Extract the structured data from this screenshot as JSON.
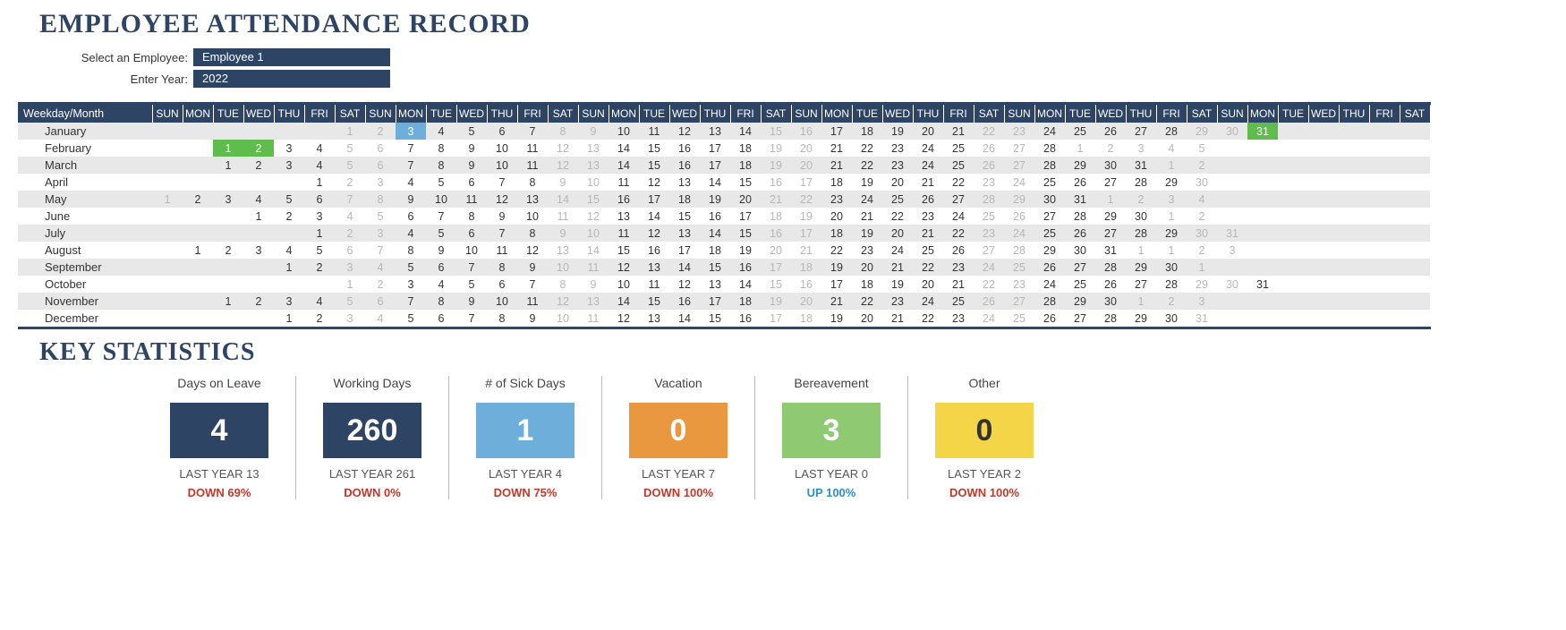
{
  "title": "EMPLOYEE ATTENDANCE RECORD",
  "controls": {
    "employee_label": "Select an Employee:",
    "employee_value": "Employee 1",
    "year_label": "Enter Year:",
    "year_value": "2022"
  },
  "calendar": {
    "header_label": "Weekday/Month",
    "weekdays_short": [
      "SUN",
      "MON",
      "TUE",
      "WED",
      "THU",
      "FRI",
      "SAT"
    ],
    "columns": 42,
    "months": [
      {
        "name": "January",
        "first_dow": 6,
        "days": 31,
        "highlights": {
          "3": "blue",
          "31": "green"
        }
      },
      {
        "name": "February",
        "first_dow": 2,
        "days": 28,
        "highlights": {
          "1": "green",
          "2": "green"
        },
        "trailing": [
          1,
          2,
          3,
          4,
          5
        ]
      },
      {
        "name": "March",
        "first_dow": 2,
        "days": 31,
        "highlights": {},
        "trailing": [
          1,
          2
        ]
      },
      {
        "name": "April",
        "first_dow": 5,
        "days": 30,
        "highlights": {}
      },
      {
        "name": "May",
        "first_dow": 0,
        "days": 31,
        "highlights": {},
        "trailing": [
          1,
          2,
          3,
          4
        ]
      },
      {
        "name": "June",
        "first_dow": 3,
        "days": 30,
        "highlights": {},
        "trailing": [
          1,
          2
        ]
      },
      {
        "name": "July",
        "first_dow": 5,
        "days": 31,
        "highlights": {}
      },
      {
        "name": "August",
        "first_dow": 1,
        "days": 31,
        "highlights": {},
        "trailing": [
          1,
          1,
          2,
          3
        ]
      },
      {
        "name": "September",
        "first_dow": 4,
        "days": 30,
        "highlights": {},
        "trailing": [
          1
        ]
      },
      {
        "name": "October",
        "first_dow": 6,
        "days": 31,
        "highlights": {}
      },
      {
        "name": "November",
        "first_dow": 2,
        "days": 30,
        "highlights": {},
        "trailing": [
          1,
          2,
          3
        ]
      },
      {
        "name": "December",
        "first_dow": 4,
        "days": 31,
        "highlights": {}
      }
    ]
  },
  "stats_title": "KEY STATISTICS",
  "stats": [
    {
      "label": "Days on Leave",
      "value": "4",
      "bg": "#2e4465",
      "fg": "#ffffff",
      "last_year": "LAST YEAR  13",
      "delta": "DOWN 69%",
      "dir": "down"
    },
    {
      "label": "Working Days",
      "value": "260",
      "bg": "#2e4465",
      "fg": "#ffffff",
      "last_year": "LAST YEAR  261",
      "delta": "DOWN 0%",
      "dir": "down"
    },
    {
      "label": "# of Sick Days",
      "value": "1",
      "bg": "#6eaedb",
      "fg": "#ffffff",
      "last_year": "LAST YEAR  4",
      "delta": "DOWN 75%",
      "dir": "down"
    },
    {
      "label": "Vacation",
      "value": "0",
      "bg": "#e9983f",
      "fg": "#ffffff",
      "last_year": "LAST YEAR  7",
      "delta": "DOWN 100%",
      "dir": "down"
    },
    {
      "label": "Bereavement",
      "value": "3",
      "bg": "#8fc972",
      "fg": "#ffffff",
      "last_year": "LAST YEAR  0",
      "delta": "UP 100%",
      "dir": "up"
    },
    {
      "label": "Other",
      "value": "0",
      "bg": "#f4d547",
      "fg": "#333333",
      "last_year": "LAST YEAR  2",
      "delta": "DOWN 100%",
      "dir": "down"
    }
  ]
}
